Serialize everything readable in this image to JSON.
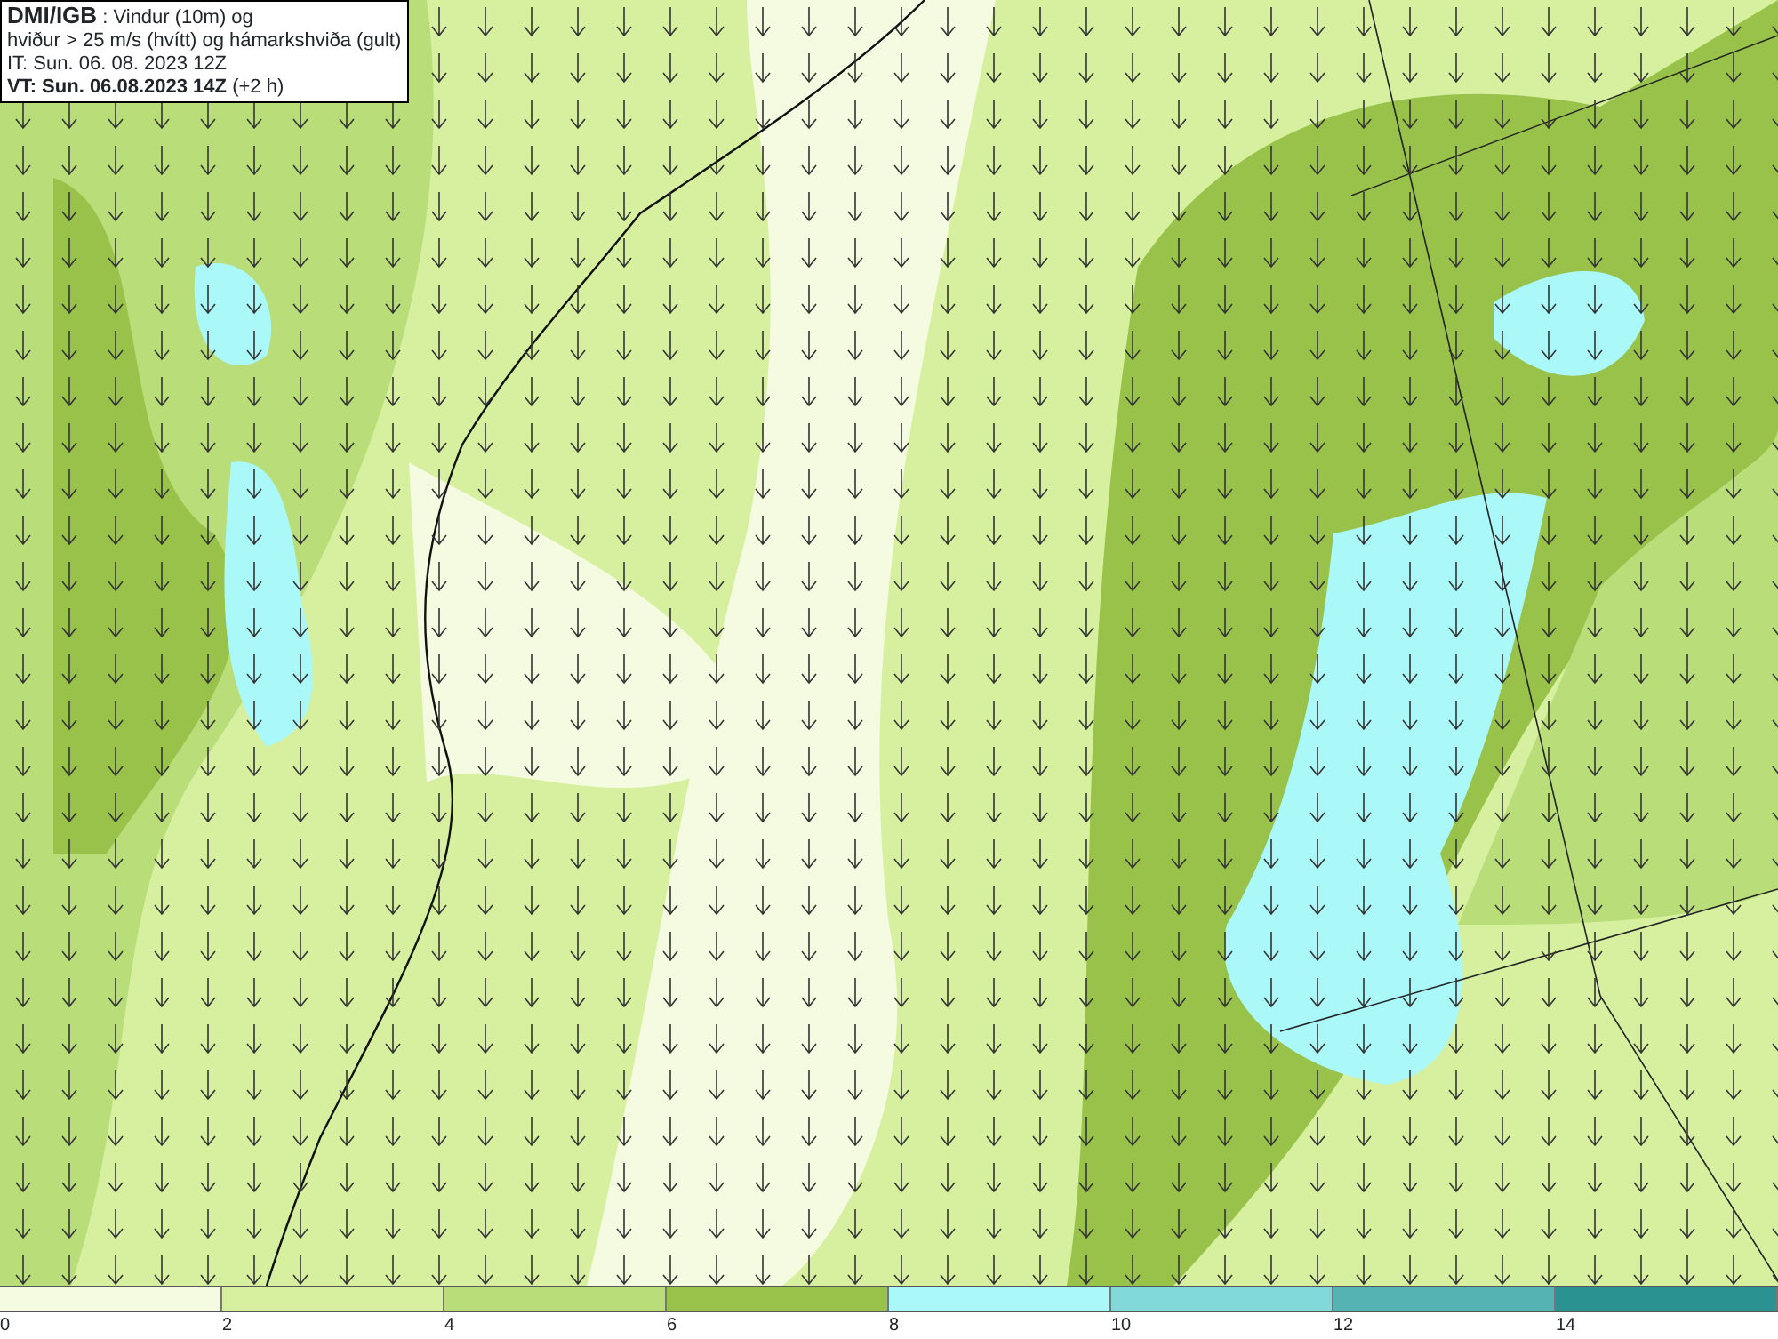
{
  "title_box": {
    "lines": [
      "**DMI/IGB** : Vindur (10m) og",
      "hviður > 25 m/s (hvítt) og hámarkshviða (gult)",
      "IT: Sun. 06. 08. 2023 12Z",
      "**VT: Sun. 06.08.2023 14Z** (+2 h)"
    ]
  },
  "legend": {
    "segments": [
      {
        "color": "#f4fbe0"
      },
      {
        "color": "#d6f0a0"
      },
      {
        "color": "#b9dd78"
      },
      {
        "color": "#98c249"
      },
      {
        "color": "#aaf8f8"
      },
      {
        "color": "#82d9d9"
      },
      {
        "color": "#55b3b3"
      },
      {
        "color": "#2b9292"
      }
    ],
    "ticks": [
      "0",
      "2",
      "4",
      "6",
      "8",
      "10",
      "12",
      "14"
    ]
  }
}
